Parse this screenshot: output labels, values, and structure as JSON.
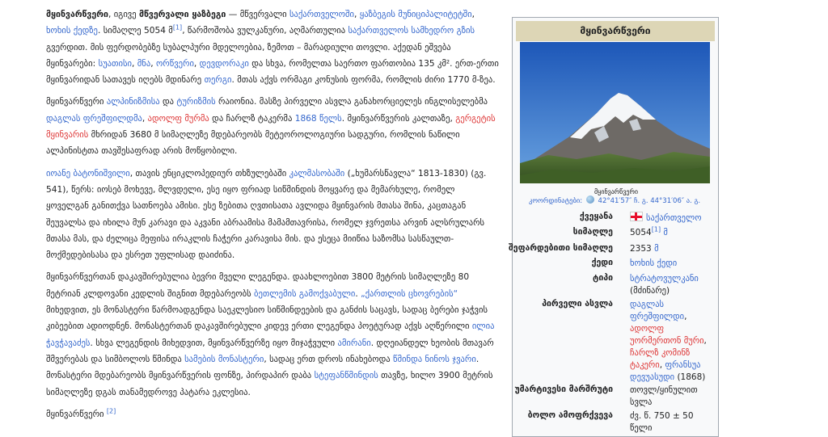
{
  "article": {
    "p1": {
      "t1": "მყინვარწვერი",
      "t2": ", იგივე ",
      "t3": "მწვერვალი ყაზბეგი",
      "t4": " — მწვერვალი ",
      "l1": "საქართველოში",
      "t5": ", ",
      "l2": "ყაზბეგის მუნიციპალიტეტში",
      "t6": ", ",
      "l3": "ხოხის ქედზე",
      "t7": ". სიმაღლე 5054 მ",
      "ref1": "[1]",
      "t8": ", წარმოშობა ვულკანური, აღმართულია ",
      "l4": "საქართველოს სამხედრო გზის",
      "t9": " გვერდით. მის ფერდობებზე სუბალპური მდელოებია, ზემოთ – მარადიული თოვლი. აქედან ეშვება მყინვარები: ",
      "l5": "სუათისი",
      "t10": ", ",
      "l6": "მნა",
      "t11": ", ",
      "l7": "ორწვერი",
      "t12": ", ",
      "l8": "დევდორაკი",
      "t13": " და სხვა, რომელთა საერთო ფართობია 135 კმ². ერთ-ერთი მყინვარიდან სათავეს იღებს მდინარე ",
      "l9": "თერგი",
      "t14": ". მთას აქვს ორმაგი კონუსის ფორმა, რომლის ძირი 1770 მ-ზეა."
    },
    "p2": {
      "t1": "მყინვარწვერი ",
      "l1": "ალპინიზმისა",
      "t2": " და ",
      "l2": "ტურიზმის",
      "t3": " რაიონია. მასზე პირველი ასვლა განახორციელეს ინგლისელებმა ",
      "l3": "დაგლას ფრეშფილდმა",
      "t4": ", ",
      "l4": "ადოლფ მურმა",
      "t5": " და ჩარლზ ტაკერმა ",
      "l5": "1868 წელს",
      "t6": ". მყინვარწვერის კალთაზე, ",
      "l6": "გერგეტის მყინვარის",
      "t7": " მხრიდან 3680 მ სიმაღლეზე მდებარეობს მეტეოროლოგიური სადგური, რომლის ნაწილი ალპინისტთა თავშესაფრად არის მოწყობილი."
    },
    "p3": {
      "l1": "იოანე ბატონიშვილი",
      "t1": ", თავის ენციკლოპედიურ თხზულებაში ",
      "l2": "კალმასობაში",
      "t2": " („ხუმარსწავლა“ 1813-1830) (გვ. 541), წერს: იოსებ მოხევე, მლვდელი, ესე იყო ფრიად სიწმინდის მოყვარე და მემარხულე, რომელ ყოველგან განითქვა სათნოება ამისი. ესე ზებითა ღვთისათა ავლიდა მყინვარის მთასა შინა, კაცთაგან შეუვალსა და იხილა მუნ კარავი და აკვანი აბრაამისა მამამთავრისა, რომელ ჯვრეთსა არვინ ალსრულარს მთასა მას, და ძელიცა მეფისა ირაკლის ჩაჭერი კარავისა მის. და ესეცა მიიწია საზომსა სასწაულთ-მოქმედებისასა და ესრეთ უფლისად დაიძინა."
    },
    "p4": {
      "t1": "მყინვარწვერთან დაკავშირებულია ბევრი მველი ლეგენდა. დაახლოებით 3800 მეტრის სიმაღლეზე 80 მეტრიან კლდოვანი კედლის შიგნით მდებარეობს ",
      "l1": "ბეთლემის გამოქვაბული",
      "t2": ". ",
      "l2": "„ქართლის ცხოვრების“",
      "t3": " მიხედვით, ეს მონასტერი წარმოადგენდა საეკლესიო სიწმინდეების და განძის საცავს, სადაც ბერები ჯაჭვის კიბეებით ადიოდნენ. მონასტერთან დაკავშირებული კიდევ ერთი ლეგენდა პოეტურად აქვს აღწერილი ",
      "l3": "ილია ჭავჭავაძეს",
      "t4": ". სხვა ლეგენდის მიხედვით, მყინვარწვერზე იყო მიჯაჭვული ",
      "l4": "ამირანი",
      "t5": ". დღეიანდელ ხეობის მთავარ შმვერებას და სიმბოლოს წმინდა ",
      "l5": "სამების მონასტერი",
      "t6": ", სადაც ერთ დროს ინახებოდა ",
      "l6": "წმინდა ნინოს ჯვარი",
      "t7": ". მონასტერი მდებარეობს მყინვარწვერის ფონზე, პირდაპირ დაბა ",
      "l7": "სტეფანწმინდის",
      "t8": " თავზე, ხილო 3900 მეტრის სიმაღლეზე დგას თანამედროვე პატარა ეკლესია."
    },
    "p5": {
      "t1": "მყინვარწვერი ",
      "ref": "[2]"
    }
  },
  "infobox": {
    "title": "მყინვარწვერი",
    "caption": "მყინვარწვერი",
    "coords_label": "კოორდინატები:",
    "coords_value": "42°41′57″ ჩ. გ. 44°31′06″ ა. გ.",
    "country_label": "ქვეყანა",
    "country_value": "საქართველო",
    "height_label": "სიმაღლე",
    "height_value": "5054",
    "height_ref": "[1]",
    "height_unit": " მ",
    "prom_label": "შეფარდებითი სიმაღლე",
    "prom_value": "2353",
    "prom_unit": " მ",
    "range_label": "ქედი",
    "range_value": "ხოხის ქედი",
    "type_label": "ტიპი",
    "type_value": "სტრატოვულკანი",
    "type_note": "(მძინარე)",
    "first_label": "პირველი ასვლა",
    "first_l1": "დაგლას ფრეშფილდი",
    "first_l2": "ადოლფ უორმერთონ მური",
    "first_l3": "ჩარლზ კომინზ ტაკერი",
    "first_l4": "ფრანსუა დევუასუდი",
    "first_year": " (1868)",
    "route_label": "უმარტივესი მარშრუტი",
    "route_value": "თოვლ/ყინულით სვლა",
    "age_label": "ბოლო ამოფრქვევა",
    "age_value": "ძვ. წ. 750 ± 50 წელი"
  },
  "colors": {
    "link": "#3366cc",
    "redlink": "#dd3333",
    "infobox_header": "#ddd6b6",
    "infobox_bg": "#f8f9fa"
  }
}
